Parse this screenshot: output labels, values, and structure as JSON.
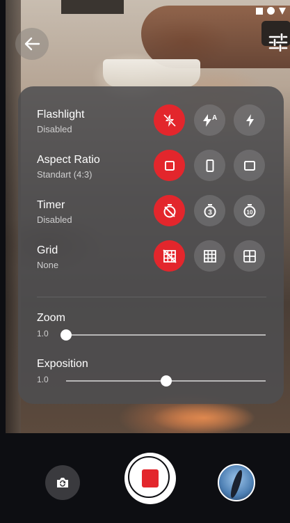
{
  "settings": [
    {
      "key": "flashlight",
      "label": "Flashlight",
      "value": "Disabled",
      "options": [
        {
          "name": "flash-off",
          "icon": "flash-off-icon",
          "active": true
        },
        {
          "name": "flash-auto",
          "icon": "flash-auto-icon",
          "active": false
        },
        {
          "name": "flash-on",
          "icon": "flash-on-icon",
          "active": false
        }
      ]
    },
    {
      "key": "aspect-ratio",
      "label": "Aspect Ratio",
      "value": "Standart (4:3)",
      "options": [
        {
          "name": "ratio-4-3",
          "icon": "ratio-standard-icon",
          "active": true
        },
        {
          "name": "ratio-tall",
          "icon": "ratio-tall-icon",
          "active": false
        },
        {
          "name": "ratio-square",
          "icon": "ratio-square-icon",
          "active": false
        }
      ]
    },
    {
      "key": "timer",
      "label": "Timer",
      "value": "Disabled",
      "options": [
        {
          "name": "timer-off",
          "icon": "timer-off-icon",
          "active": true
        },
        {
          "name": "timer-3",
          "icon": "timer-3-icon",
          "active": false
        },
        {
          "name": "timer-10",
          "icon": "timer-10-icon",
          "active": false
        }
      ]
    },
    {
      "key": "grid",
      "label": "Grid",
      "value": "None",
      "options": [
        {
          "name": "grid-none",
          "icon": "grid-off-icon",
          "active": true
        },
        {
          "name": "grid-3x3",
          "icon": "grid-3x3-icon",
          "active": false
        },
        {
          "name": "grid-2x2",
          "icon": "grid-2x2-icon",
          "active": false
        }
      ]
    }
  ],
  "sliders": [
    {
      "key": "zoom",
      "label": "Zoom",
      "value": "1.0",
      "level": 0
    },
    {
      "key": "exposition",
      "label": "Exposition",
      "value": "1.0",
      "level": 0.5
    }
  ],
  "icons": {
    "back": "arrow-left-icon",
    "filters": "sliders-icon",
    "switch_camera": "switch-camera-icon",
    "shutter": "record-icon",
    "gallery": "gallery-thumbnail"
  },
  "colors": {
    "accent": "#e3262c",
    "panel": "#4e4e50",
    "bottom_bar": "#0d0e12"
  }
}
